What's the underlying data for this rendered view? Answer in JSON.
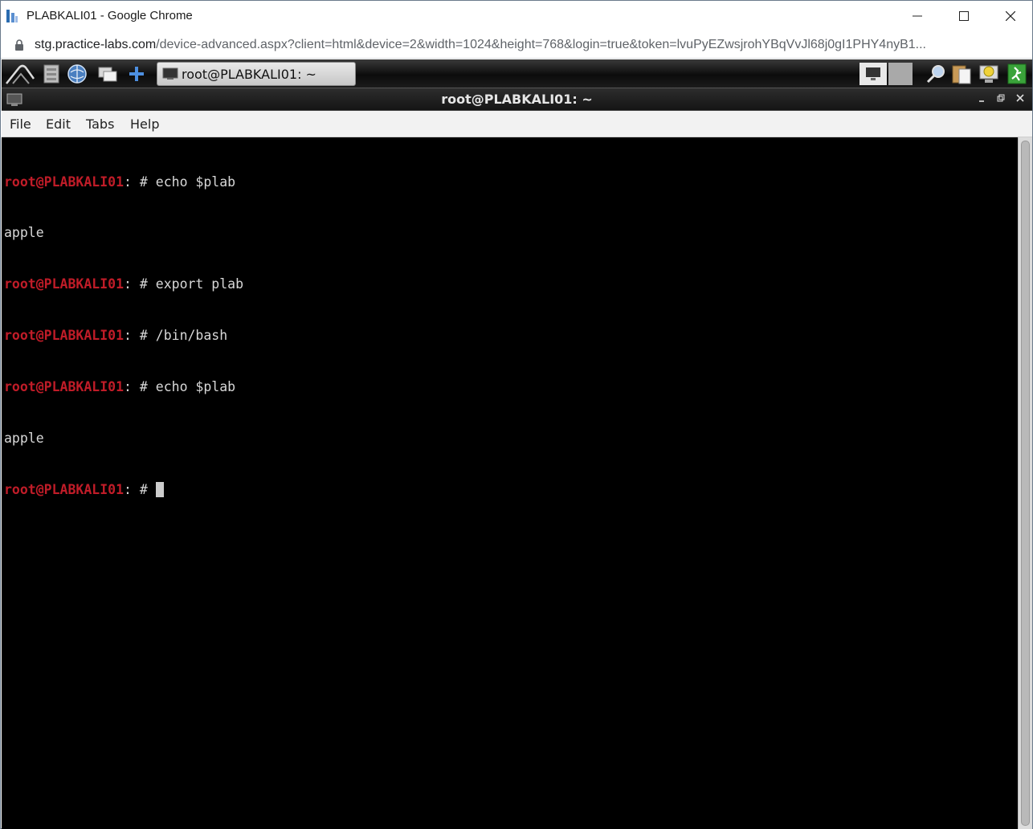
{
  "browser": {
    "window_title": "PLABKALI01 - Google Chrome",
    "url_host": "stg.practice-labs.com",
    "url_rest": "/device-advanced.aspx?client=html&device=2&width=1024&height=768&login=true&token=lvuPyEZwsjrohYBqVvJl68j0gI1PHY4nyB1..."
  },
  "taskbar": {
    "launcher_icons": [
      "kali-menu-icon",
      "file-manager-icon",
      "browser-globe-icon",
      "show-desktop-icon",
      "add-plus-icon"
    ],
    "active_task_label": "root@PLABKALI01: ~",
    "tray_icons": [
      "monitor-icon",
      "blank-icon",
      "search-magnifier-icon",
      "clipboard-icon",
      "power-manager-icon",
      "logout-exit-icon"
    ]
  },
  "terminal": {
    "title": "root@PLABKALI01: ~",
    "menu": [
      "File",
      "Edit",
      "Tabs",
      "Help"
    ],
    "lines": [
      {
        "host": "root@PLABKALI01",
        "sep": ": # ",
        "cmd": "echo $plab"
      },
      {
        "output": "apple"
      },
      {
        "host": "root@PLABKALI01",
        "sep": ": # ",
        "cmd": "export plab"
      },
      {
        "host": "root@PLABKALI01",
        "sep": ": # ",
        "cmd": "/bin/bash"
      },
      {
        "host": "root@PLABKALI01",
        "sep": ": # ",
        "cmd": "echo $plab"
      },
      {
        "output": "apple"
      },
      {
        "host": "root@PLABKALI01",
        "sep": ": # ",
        "cmd": "",
        "cursor": true
      }
    ]
  },
  "colors": {
    "prompt_host": "#c01c28",
    "terminal_bg": "#000000",
    "terminal_fg": "#d8d8d8"
  }
}
